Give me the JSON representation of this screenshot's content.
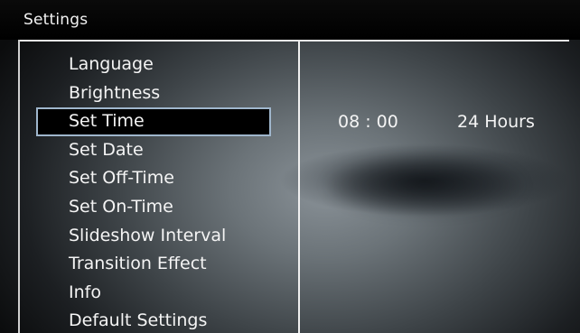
{
  "header": {
    "title": "Settings"
  },
  "menu": {
    "items": [
      {
        "label": "Language",
        "selected": false
      },
      {
        "label": "Brightness",
        "selected": false
      },
      {
        "label": "Set Time",
        "selected": true
      },
      {
        "label": "Set Date",
        "selected": false
      },
      {
        "label": "Set Off-Time",
        "selected": false
      },
      {
        "label": "Set On-Time",
        "selected": false
      },
      {
        "label": "Slideshow Interval",
        "selected": false
      },
      {
        "label": "Transition Effect",
        "selected": false
      },
      {
        "label": "Info",
        "selected": false
      },
      {
        "label": "Default Settings",
        "selected": false
      }
    ]
  },
  "detail": {
    "time": "08 : 00",
    "format": "24 Hours"
  },
  "colors": {
    "selection_border": "#9fb6cc",
    "text": "#f4f4f4"
  }
}
